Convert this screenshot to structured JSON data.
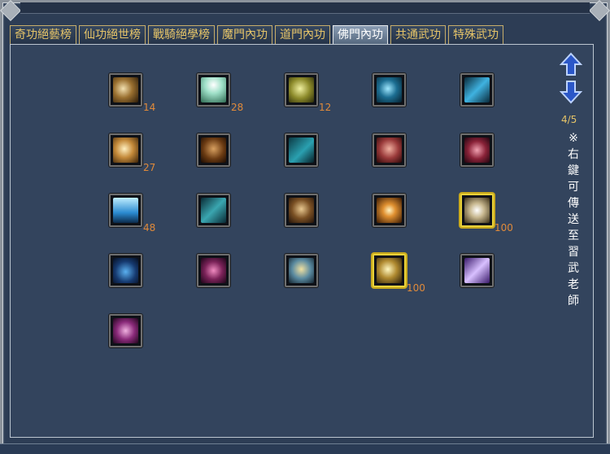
{
  "tabs": [
    {
      "label": "奇功絕藝榜",
      "active": false
    },
    {
      "label": "仙功絕世榜",
      "active": false
    },
    {
      "label": "戰騎絕學榜",
      "active": false
    },
    {
      "label": "魔門內功",
      "active": false
    },
    {
      "label": "道門內功",
      "active": false
    },
    {
      "label": "佛門內功",
      "active": true
    },
    {
      "label": "共通武功",
      "active": false
    },
    {
      "label": "特殊武功",
      "active": false
    }
  ],
  "page_indicator": "4/5",
  "hint": "※右鍵可傳送至習武老師",
  "skills": [
    {
      "icon": "skill-palm-icon",
      "count": "14"
    },
    {
      "icon": "skill-radiance-icon",
      "count": "28"
    },
    {
      "icon": "skill-golden-swirl-icon",
      "count": "12"
    },
    {
      "icon": "skill-blue-orb-icon",
      "count": ""
    },
    {
      "icon": "skill-blue-blade-icon",
      "count": ""
    },
    {
      "icon": "skill-golden-burst-icon",
      "count": "27"
    },
    {
      "icon": "skill-figure-icon",
      "count": ""
    },
    {
      "icon": "skill-teal-wave-icon",
      "count": ""
    },
    {
      "icon": "skill-red-warrior-icon",
      "count": ""
    },
    {
      "icon": "skill-crimson-spiral-icon",
      "count": ""
    },
    {
      "icon": "skill-ice-pillars-icon",
      "count": "48"
    },
    {
      "icon": "skill-crossed-blades-icon",
      "count": ""
    },
    {
      "icon": "skill-bronze-fist-icon",
      "count": ""
    },
    {
      "icon": "skill-sunburst-icon",
      "count": ""
    },
    {
      "icon": "skill-white-swirl-icon",
      "count": "100",
      "selected": true
    },
    {
      "icon": "skill-meditation-icon",
      "count": ""
    },
    {
      "icon": "skill-magenta-figure-icon",
      "count": ""
    },
    {
      "icon": "skill-golden-kick-icon",
      "count": ""
    },
    {
      "icon": "skill-golden-strike-icon",
      "count": "100",
      "selected": true
    },
    {
      "icon": "skill-violet-flash-icon",
      "count": ""
    },
    {
      "icon": "skill-purple-aura-icon",
      "count": ""
    }
  ]
}
